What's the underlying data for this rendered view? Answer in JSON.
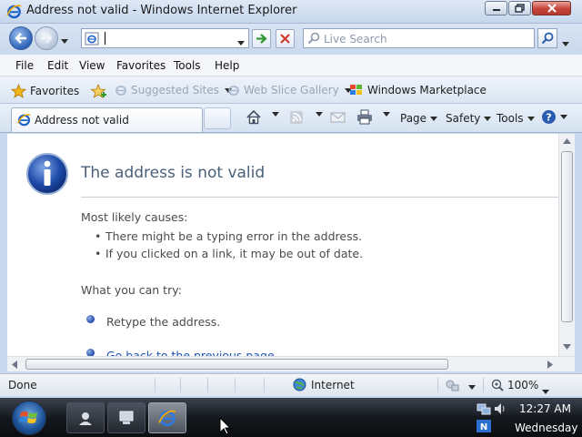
{
  "window": {
    "title": "Address not valid - Windows Internet Explorer"
  },
  "address_bar": {
    "value": "",
    "search_placeholder": "Live Search"
  },
  "menu": [
    "File",
    "Edit",
    "View",
    "Favorites",
    "Tools",
    "Help"
  ],
  "favorites_bar": {
    "favorites_label": "Favorites",
    "items": [
      {
        "label": "Suggested Sites",
        "enabled": false
      },
      {
        "label": "Web Slice Gallery",
        "enabled": false
      },
      {
        "label": "Windows Marketplace",
        "enabled": true
      }
    ]
  },
  "tab": {
    "label": "Address not valid"
  },
  "command_bar": {
    "page": "Page",
    "safety": "Safety",
    "tools": "Tools"
  },
  "content": {
    "title": "The address is not valid",
    "causes_heading": "Most likely causes:",
    "causes": [
      "There might be a typing error in the address.",
      "If you clicked on a link, it may be out of date."
    ],
    "try_heading": "What you can try:",
    "try_items": [
      "Retype the address.",
      "Go back to the previous page."
    ]
  },
  "status_bar": {
    "status": "Done",
    "zone": "Internet",
    "zoom": "100%"
  },
  "taskbar": {
    "time": "12:27 AM",
    "day": "Wednesday"
  },
  "colors": {
    "ie_blue": "#1e62c8",
    "link": "#1e4fb4",
    "title_text": "#4a607a"
  },
  "icons": [
    "ie-icon",
    "back-arrow-icon",
    "forward-arrow-icon",
    "refresh-go-icon",
    "stop-icon",
    "search-icon",
    "favorites-star-icon",
    "add-favorites-icon",
    "home-icon",
    "rss-feed-icon",
    "read-mail-icon",
    "print-icon",
    "help-icon",
    "info-icon",
    "globe-icon",
    "zoom-icon",
    "windows-start-icon"
  ]
}
